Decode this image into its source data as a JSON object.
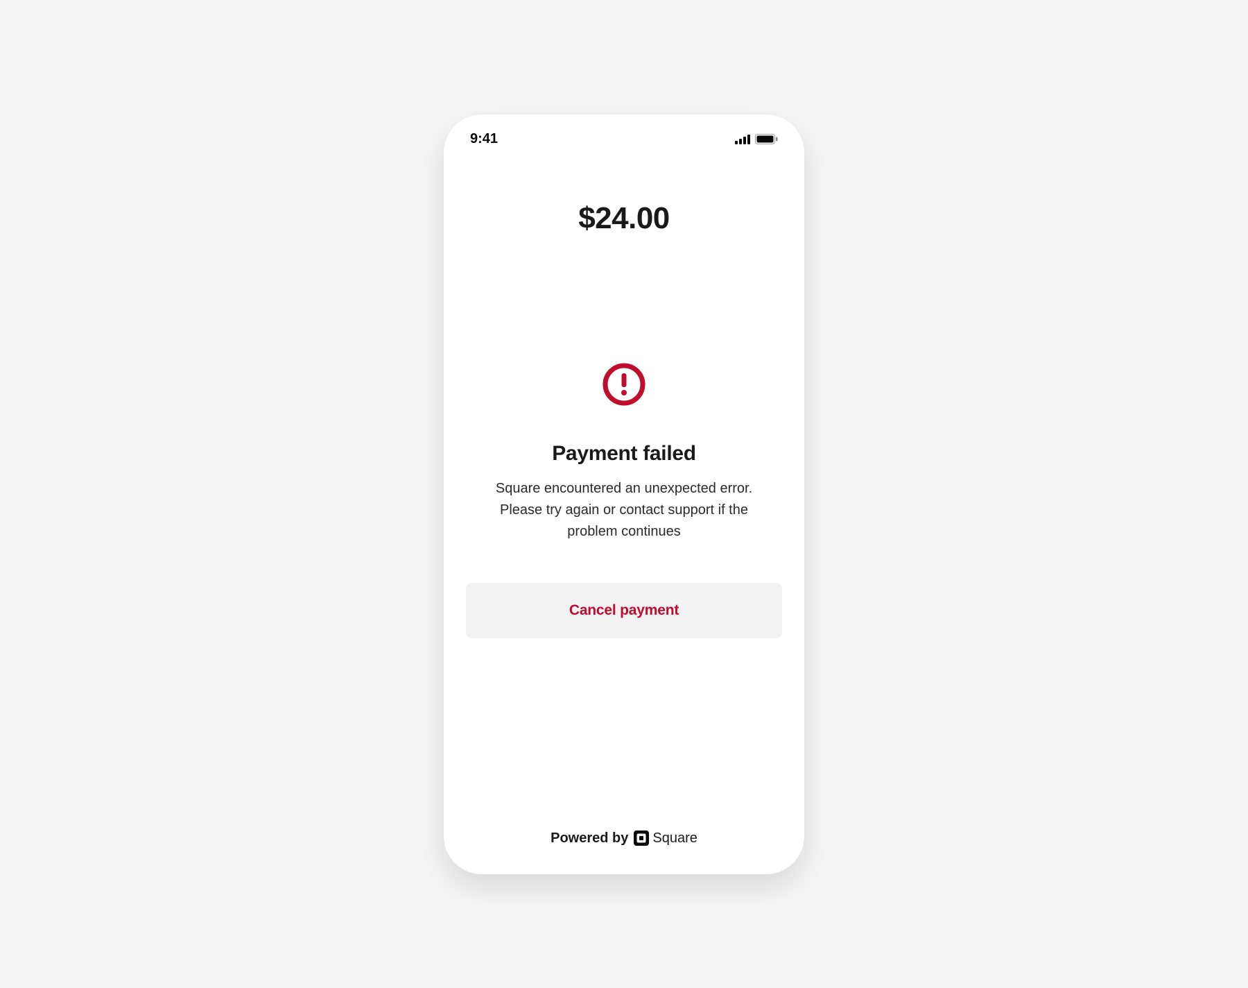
{
  "status_bar": {
    "time": "9:41"
  },
  "payment": {
    "amount": "$24.00"
  },
  "error": {
    "title": "Payment failed",
    "message": "Square encountered an unexpected error. Please try again or contact support if the problem continues"
  },
  "actions": {
    "cancel_label": "Cancel payment"
  },
  "footer": {
    "powered_by": "Powered by",
    "brand": "Square"
  },
  "colors": {
    "error_red": "#bf0d2e",
    "button_bg": "#f3f2f2"
  }
}
